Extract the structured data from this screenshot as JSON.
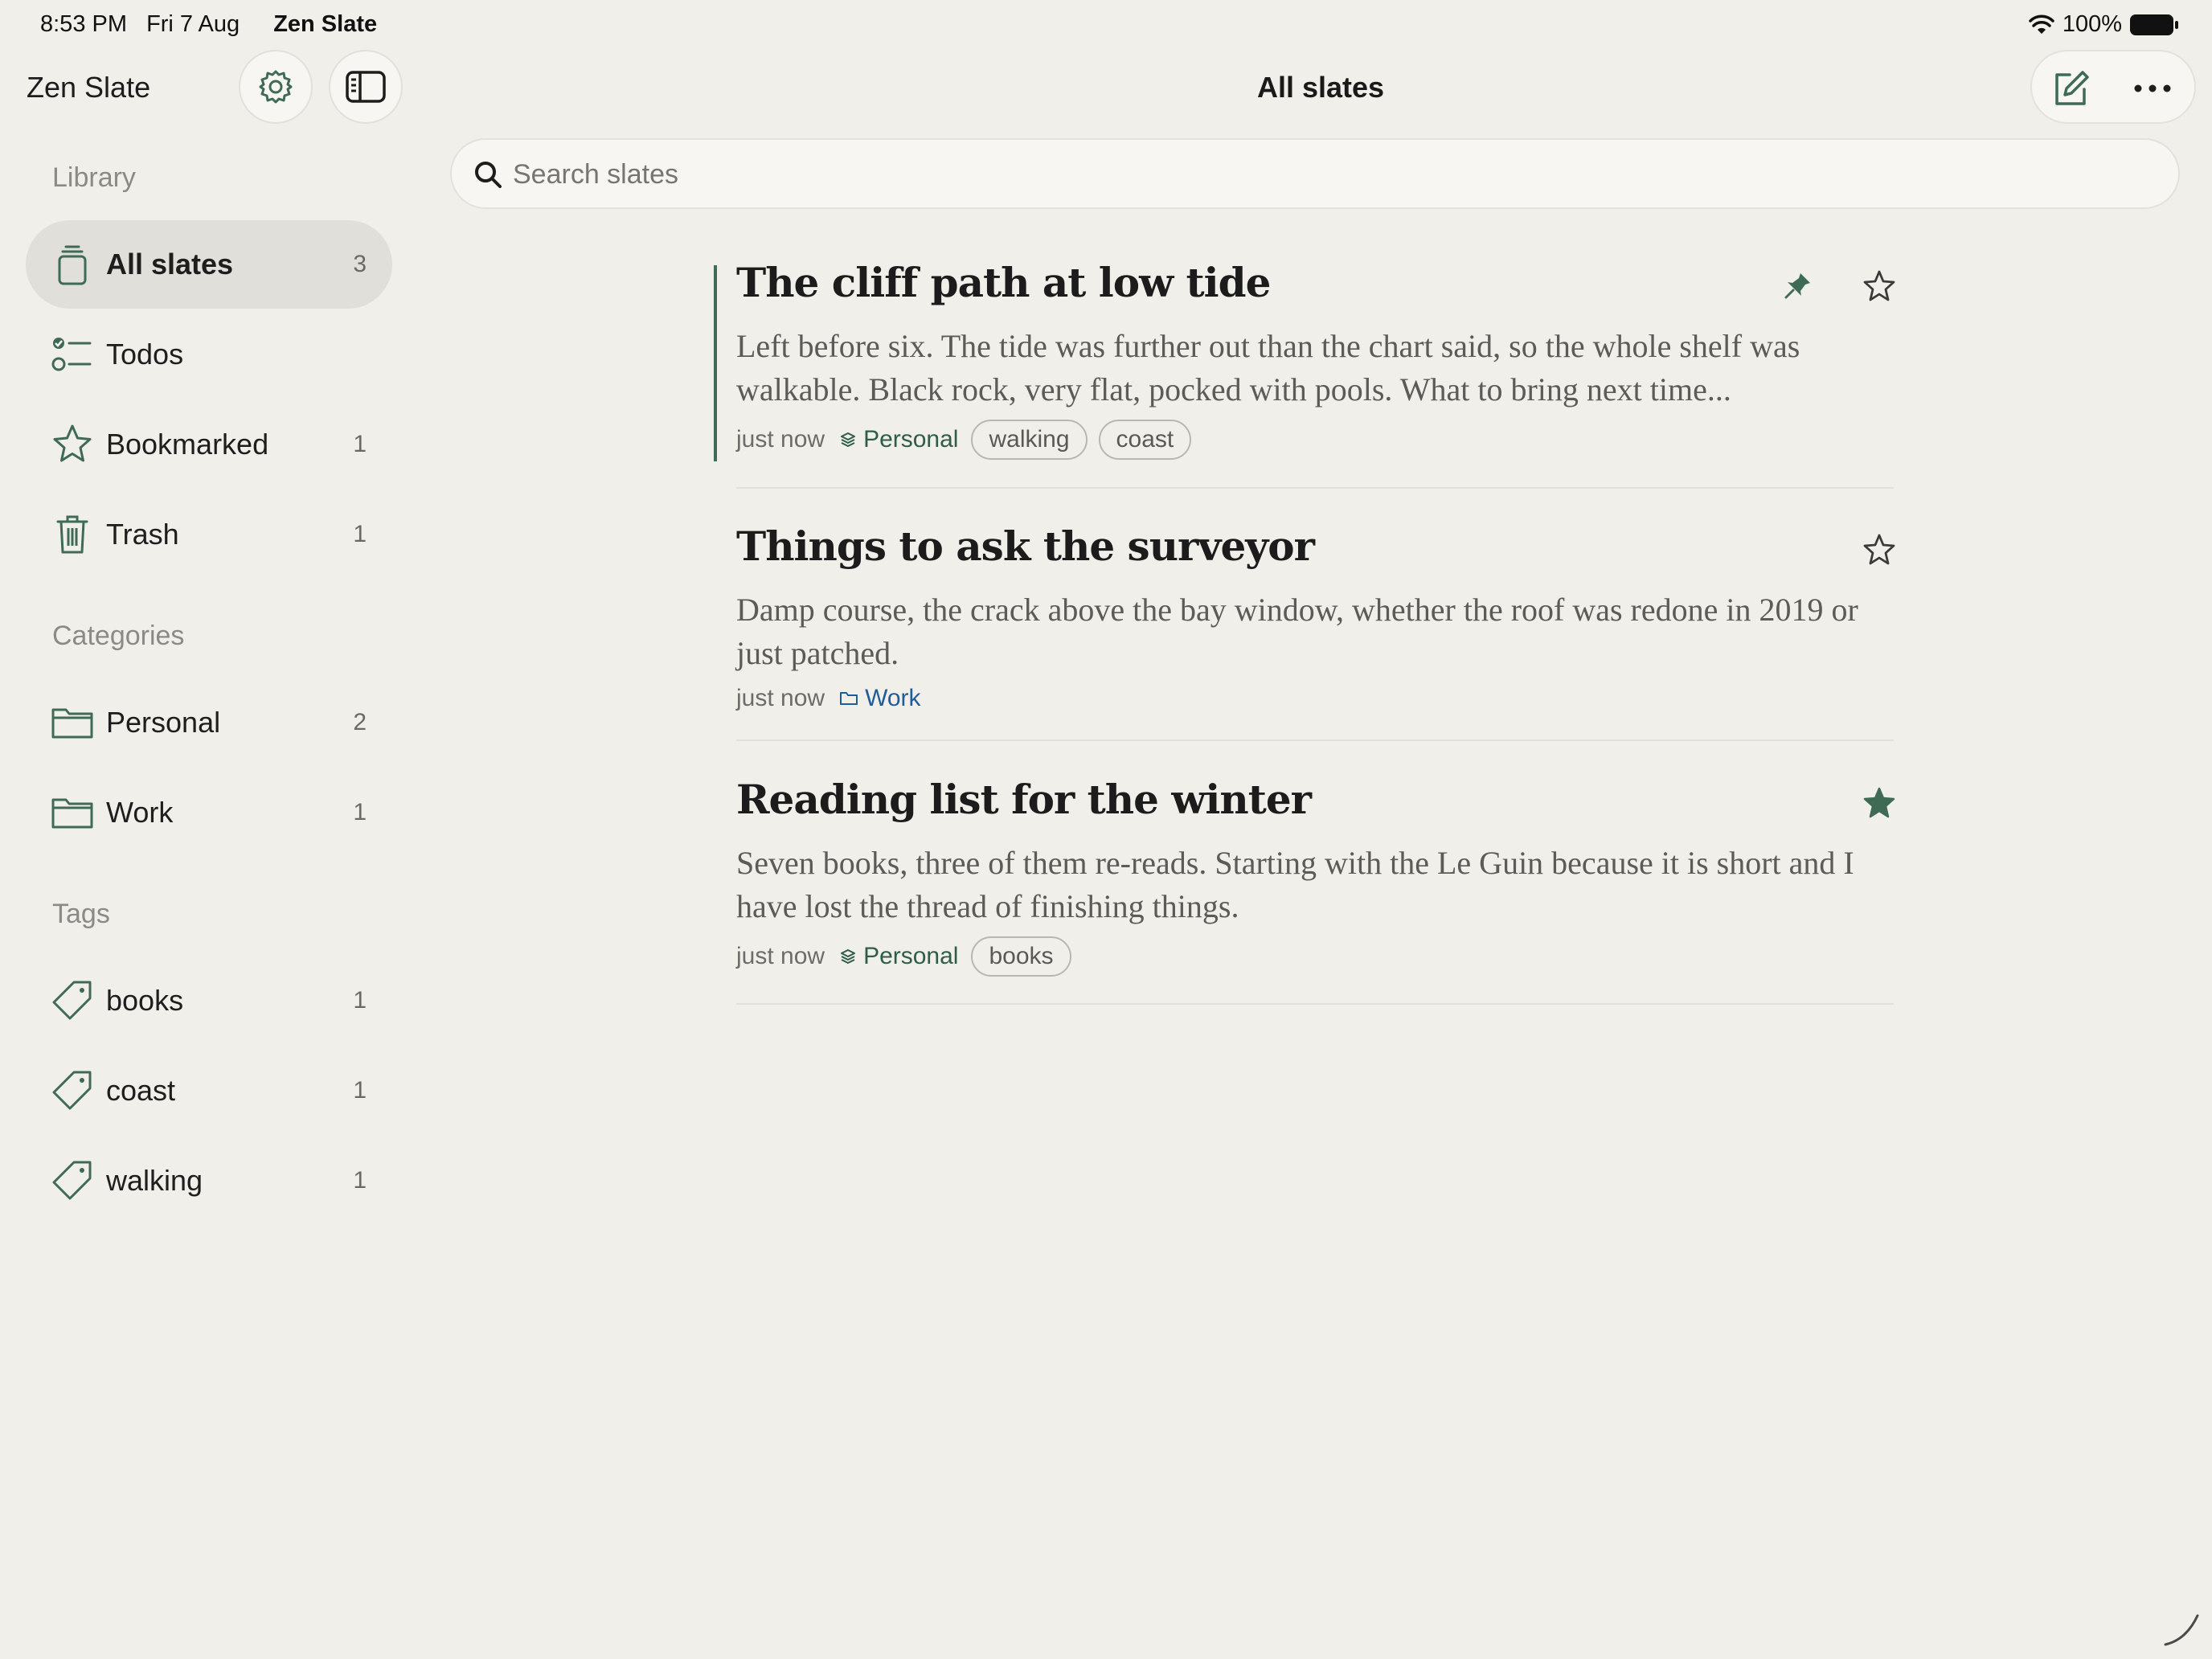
{
  "status_bar": {
    "time": "8:53 PM",
    "date": "Fri 7 Aug",
    "app_name": "Zen Slate",
    "battery": "100%"
  },
  "sidebar": {
    "app_title": "Zen Slate",
    "sections": {
      "library": "Library",
      "categories": "Categories",
      "tags": "Tags"
    },
    "library_items": [
      {
        "label": "All slates",
        "count": "3",
        "icon": "stack-icon",
        "active": true
      },
      {
        "label": "Todos",
        "count": "",
        "icon": "checklist-icon"
      },
      {
        "label": "Bookmarked",
        "count": "1",
        "icon": "star-icon"
      },
      {
        "label": "Trash",
        "count": "1",
        "icon": "trash-icon"
      }
    ],
    "category_items": [
      {
        "label": "Personal",
        "count": "2",
        "icon": "folder-icon"
      },
      {
        "label": "Work",
        "count": "1",
        "icon": "folder-icon"
      }
    ],
    "tag_items": [
      {
        "label": "books",
        "count": "1",
        "icon": "tag-icon"
      },
      {
        "label": "coast",
        "count": "1",
        "icon": "tag-icon"
      },
      {
        "label": "walking",
        "count": "1",
        "icon": "tag-icon"
      }
    ]
  },
  "header": {
    "title": "All slates"
  },
  "search": {
    "placeholder": "Search slates",
    "value": ""
  },
  "notes": [
    {
      "title": "The cliff path at low tide",
      "body": "Left before six. The tide was further out than the chart said, so the whole shelf was walkable. Black rock, very flat, pocked with pools. What to bring next time...",
      "time": "just now",
      "category": "Personal",
      "tags": [
        "walking",
        "coast"
      ],
      "pinned": true,
      "starred": false
    },
    {
      "title": "Things to ask the surveyor",
      "body": "Damp course, the crack above the bay window, whether the roof was redone in 2019 or just patched.",
      "time": "just now",
      "category": "Work",
      "tags": [],
      "pinned": false,
      "starred": false
    },
    {
      "title": "Reading list for the winter",
      "body": "Seven books, three of them re-reads. Starting with the Le Guin because it is short and I have lost the thread of finishing things.",
      "time": "just now",
      "category": "Personal",
      "tags": [
        "books"
      ],
      "pinned": false,
      "starred": true
    }
  ],
  "colors": {
    "accent_green": "#3f6b55",
    "work_blue": "#1f5c9a",
    "background": "#f1efea"
  }
}
